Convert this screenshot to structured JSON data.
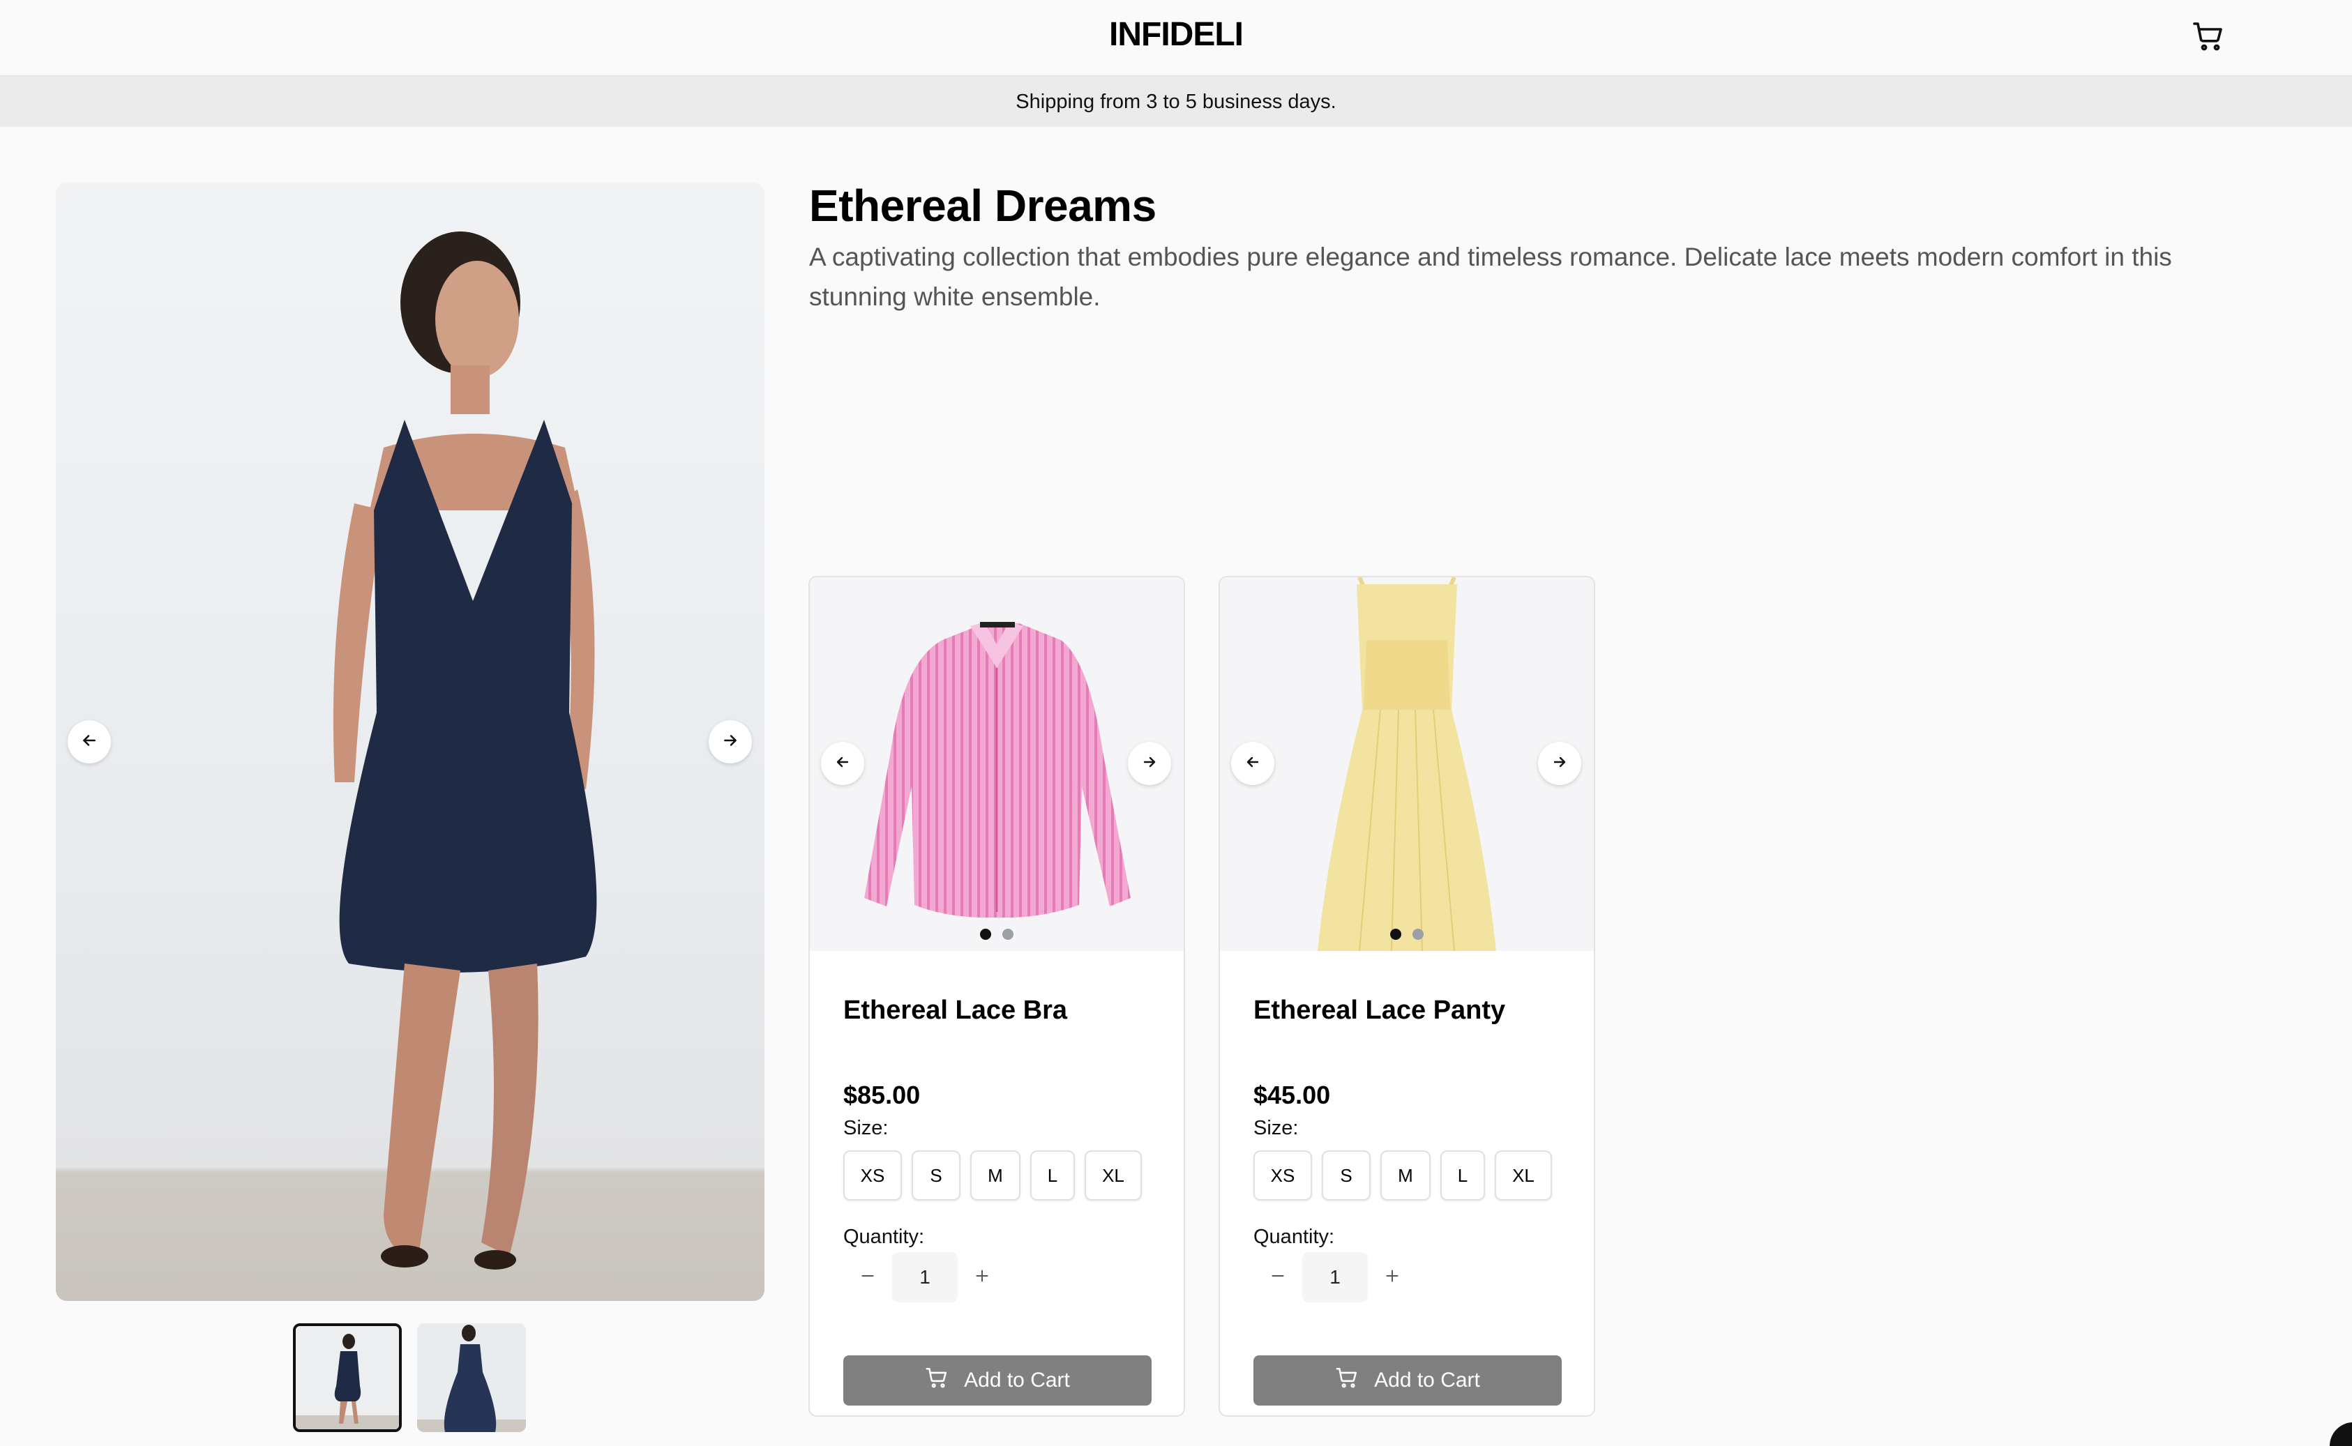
{
  "header": {
    "brand": "INFIDELI",
    "cart_icon": "cart-icon"
  },
  "banner": {
    "text": "Shipping from 3 to 5 business days."
  },
  "gallery": {
    "prev_icon": "arrow-left-icon",
    "next_icon": "arrow-right-icon",
    "main_image": "model-in-navy-denim-halter-dress",
    "thumbnails": [
      "navy-halter-dress-thumbnail",
      "navy-long-dress-thumbnail"
    ],
    "active_thumbnail": 0
  },
  "collection": {
    "title": "Ethereal Dreams",
    "description": "A captivating collection that embodies pure elegance and timeless romance. Delicate lace meets modern comfort in this stunning white ensemble."
  },
  "products": [
    {
      "name": "Ethereal Lace Bra",
      "price": "$85.00",
      "image": "pink-striped-shirt",
      "image_dots": 2,
      "active_dot": 0,
      "size_label": "Size:",
      "sizes": [
        "XS",
        "S",
        "M",
        "L",
        "XL"
      ],
      "quantity_label": "Quantity:",
      "quantity": "1",
      "button": "Add to Cart"
    },
    {
      "name": "Ethereal Lace Panty",
      "price": "$45.00",
      "image": "yellow-sundress",
      "image_dots": 2,
      "active_dot": 0,
      "size_label": "Size:",
      "sizes": [
        "XS",
        "S",
        "M",
        "L",
        "XL"
      ],
      "quantity_label": "Quantity:",
      "quantity": "1",
      "button": "Add to Cart"
    }
  ],
  "colors": {
    "button_gray": "#808080",
    "banner_bg": "#ebebeb",
    "dot_active": "#111111",
    "dot_inactive": "#9aa0a6"
  }
}
